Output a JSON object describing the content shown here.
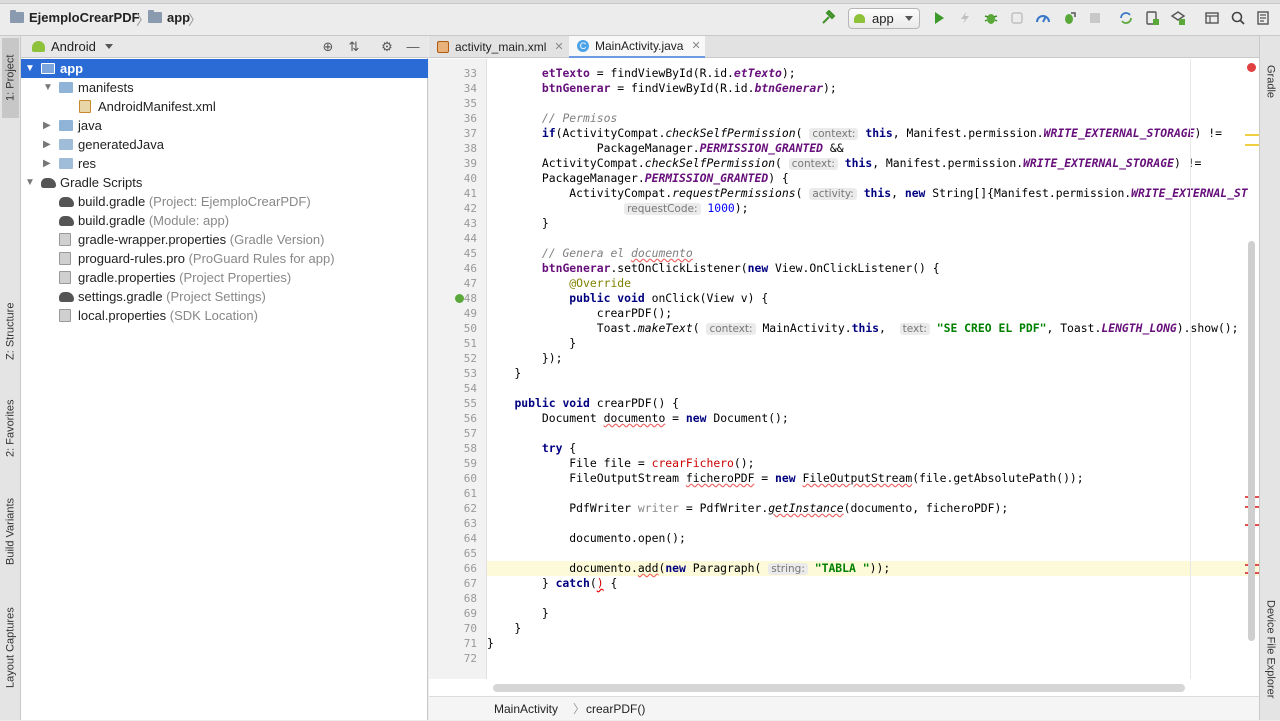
{
  "nav": {
    "project": "EjemploCrearPDF",
    "module": "app",
    "run_config": "app"
  },
  "left_stripe": {
    "project": "1: Project",
    "structure": "Z: Structure",
    "favorites": "2: Favorites",
    "build_variants": "Build Variants",
    "layout_captures": "Layout Captures"
  },
  "right_stripe": {
    "gradle": "Gradle",
    "device_explorer": "Device File Explorer"
  },
  "project_panel": {
    "view": "Android",
    "tree": [
      {
        "label": "app",
        "hint": "",
        "depth": 0,
        "twisty": "▼",
        "icon": "folder-app",
        "selected": true
      },
      {
        "label": "manifests",
        "hint": "",
        "depth": 1,
        "twisty": "▼",
        "icon": "folder-blue",
        "selected": false
      },
      {
        "label": "AndroidManifest.xml",
        "hint": "",
        "depth": 2,
        "twisty": "",
        "icon": "xml",
        "selected": false
      },
      {
        "label": "java",
        "hint": "",
        "depth": 1,
        "twisty": "▶",
        "icon": "folder-blue",
        "selected": false
      },
      {
        "label": "generatedJava",
        "hint": "",
        "depth": 1,
        "twisty": "▶",
        "icon": "folder-gen",
        "selected": false
      },
      {
        "label": "res",
        "hint": "",
        "depth": 1,
        "twisty": "▶",
        "icon": "folder-res",
        "selected": false
      },
      {
        "label": "Gradle Scripts",
        "hint": "",
        "depth": 0,
        "twisty": "▼",
        "icon": "elephant",
        "selected": false
      },
      {
        "label": "build.gradle",
        "hint": " (Project: EjemploCrearPDF)",
        "depth": 1,
        "twisty": "",
        "icon": "elephant",
        "selected": false
      },
      {
        "label": "build.gradle",
        "hint": " (Module: app)",
        "depth": 1,
        "twisty": "",
        "icon": "elephant",
        "selected": false
      },
      {
        "label": "gradle-wrapper.properties",
        "hint": " (Gradle Version)",
        "depth": 1,
        "twisty": "",
        "icon": "props",
        "selected": false
      },
      {
        "label": "proguard-rules.pro",
        "hint": " (ProGuard Rules for app)",
        "depth": 1,
        "twisty": "",
        "icon": "props",
        "selected": false
      },
      {
        "label": "gradle.properties",
        "hint": " (Project Properties)",
        "depth": 1,
        "twisty": "",
        "icon": "props",
        "selected": false
      },
      {
        "label": "settings.gradle",
        "hint": " (Project Settings)",
        "depth": 1,
        "twisty": "",
        "icon": "elephant",
        "selected": false
      },
      {
        "label": "local.properties",
        "hint": " (SDK Location)",
        "depth": 1,
        "twisty": "",
        "icon": "props",
        "selected": false
      }
    ]
  },
  "editor": {
    "tabs": [
      {
        "label": "activity_main.xml",
        "icon": "xml",
        "active": false
      },
      {
        "label": "MainActivity.java",
        "icon": "class",
        "active": true
      }
    ],
    "current_line": 66,
    "lines": [
      {
        "n": 33,
        "html": "        <span class=\"fld\">etTexto</span> = findViewById(R.id.<span class=\"fld it\">etTexto</span>);"
      },
      {
        "n": 34,
        "html": "        <span class=\"fld\">btnGenerar</span> = findViewById(R.id.<span class=\"fld it\">btnGenerar</span>);"
      },
      {
        "n": 35,
        "html": ""
      },
      {
        "n": 36,
        "html": "        <span class=\"cmt\">// Permisos</span>"
      },
      {
        "n": 37,
        "html": "        <span class=\"kw\">if</span>(ActivityCompat.<span class=\"it\">checkSelfPermission</span>( <span class=\"hintbox\">context:</span> <span class=\"kw\">this</span>, Manifest.permission.<span class=\"fld it\">WRITE_EXTERNAL_STORAGE</span>) !="
      },
      {
        "n": 38,
        "html": "                PackageManager.<span class=\"fld it\">PERMISSION_GRANTED</span> &amp;&amp;"
      },
      {
        "n": 39,
        "html": "        ActivityCompat.<span class=\"it\">checkSelfPermission</span>( <span class=\"hintbox\">context:</span> <span class=\"kw\">this</span>, Manifest.permission.<span class=\"fld it\">WRITE_EXTERNAL_STORAGE</span>) !="
      },
      {
        "n": 40,
        "html": "        PackageManager.<span class=\"fld it\">PERMISSION_GRANTED</span>) {"
      },
      {
        "n": 41,
        "html": "            ActivityCompat.<span class=\"it\">requestPermissions</span>( <span class=\"hintbox\">activity:</span> <span class=\"kw\">this</span>, <span class=\"kw\">new</span> String[]{Manifest.permission.<span class=\"fld it\">WRITE_EXTERNAL_ST</span>"
      },
      {
        "n": 42,
        "html": "                    <span class=\"hintbox\">requestCode:</span> <span class=\"num\">1000</span>);"
      },
      {
        "n": 43,
        "html": "        }"
      },
      {
        "n": 44,
        "html": ""
      },
      {
        "n": 45,
        "html": "        <span class=\"cmt\">// Genera el <span class=\"wavy\">documento</span></span>"
      },
      {
        "n": 46,
        "html": "        <span class=\"fld\">btnGenerar</span>.setOnClickListener(<span class=\"kw\">new</span> View.OnClickListener() {"
      },
      {
        "n": 47,
        "html": "            <span class=\"ann\">@Override</span>"
      },
      {
        "n": 48,
        "html": "            <span class=\"kw\">public void</span> onClick(View v) {"
      },
      {
        "n": 49,
        "html": "                crearPDF();"
      },
      {
        "n": 50,
        "html": "                Toast.<span class=\"it\">makeText</span>( <span class=\"hintbox\">context:</span> MainActivity.<span class=\"kw\">this</span>,  <span class=\"hintbox\">text:</span> <span class=\"str\">\"SE CREO EL PDF\"</span>, Toast.<span class=\"fld it\">LENGTH_LONG</span>).show();"
      },
      {
        "n": 51,
        "html": "            }"
      },
      {
        "n": 52,
        "html": "        });"
      },
      {
        "n": 53,
        "html": "    }"
      },
      {
        "n": 54,
        "html": ""
      },
      {
        "n": 55,
        "html": "    <span class=\"kw\">public void</span> crearPDF() {"
      },
      {
        "n": 56,
        "html": "        Document <span class=\"wavy\">documento</span> = <span class=\"kw\">new</span> Document();"
      },
      {
        "n": 57,
        "html": ""
      },
      {
        "n": 58,
        "html": "        <span class=\"kw\">try</span> {"
      },
      {
        "n": 59,
        "html": "            File file = <span class=\"err\" style=\"text-decoration:none;color:#c00\">crearFichero</span>();"
      },
      {
        "n": 60,
        "html": "            FileOutputStream <span class=\"wavy\">ficheroPDF</span> = <span class=\"kw\">new</span> <span class=\"wavy\">FileOutputStream</span>(file.getAbsolutePath());"
      },
      {
        "n": 61,
        "html": ""
      },
      {
        "n": 62,
        "html": "            PdfWriter <span class=\"dim\">writer</span> = PdfWriter.<span class=\"it wavy\">getInstance</span>(documento, ficheroPDF);"
      },
      {
        "n": 63,
        "html": ""
      },
      {
        "n": 64,
        "html": "            documento.open();"
      },
      {
        "n": 65,
        "html": ""
      },
      {
        "n": 66,
        "html": "            documento.<span class=\"wavy\">add</span>(<span class=\"kw\">new</span> Paragraph( <span class=\"hintbox\">string:</span> <span class=\"str\">\"TABLA \"</span>));"
      },
      {
        "n": 67,
        "html": "        } <span class=\"kw\">catch</span>(<span class=\"err\">)</span> {"
      },
      {
        "n": 68,
        "html": ""
      },
      {
        "n": 69,
        "html": "        }"
      },
      {
        "n": 70,
        "html": "    }"
      },
      {
        "n": 71,
        "html": "}"
      },
      {
        "n": 72,
        "html": ""
      }
    ],
    "breadcrumbs": [
      "MainActivity",
      "crearPDF()"
    ]
  }
}
